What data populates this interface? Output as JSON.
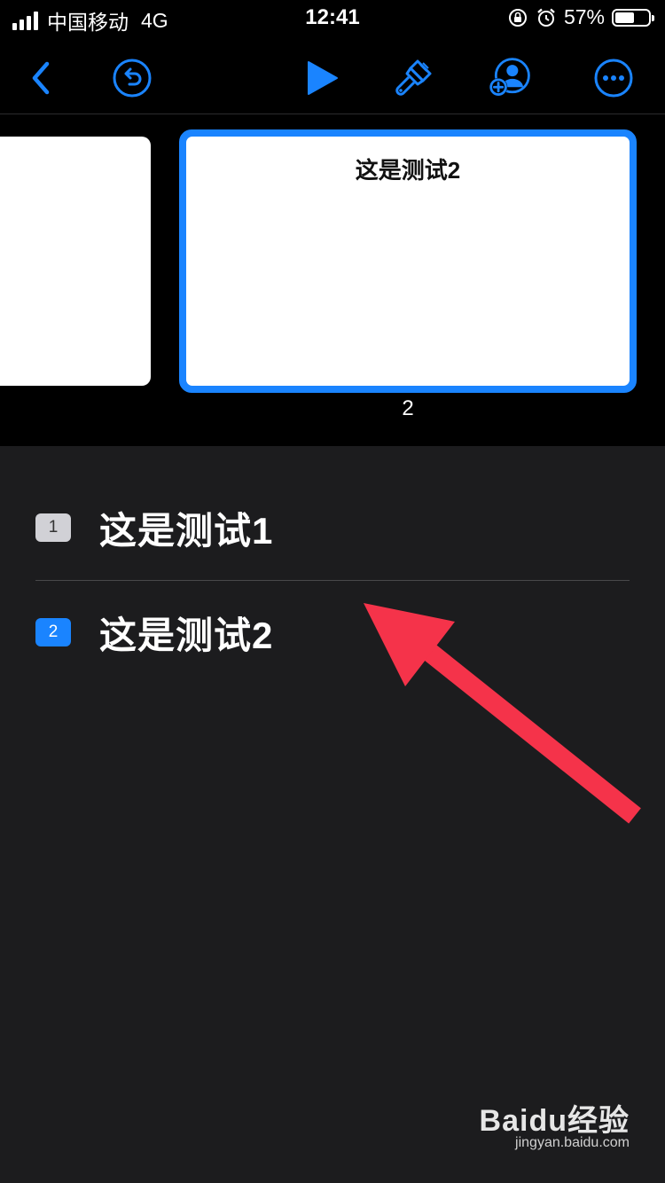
{
  "status_bar": {
    "carrier": "中国移动",
    "network": "4G",
    "time": "12:41",
    "battery_percent": "57%",
    "battery_level": 0.57
  },
  "toolbar": {
    "icons": [
      "back-chevron-icon",
      "undo-icon",
      "play-icon",
      "paintbrush-icon",
      "add-collaborator-icon",
      "more-icon"
    ],
    "accent_color": "#1a84ff"
  },
  "slides": {
    "current_title": "这是测试2",
    "current_number": "2"
  },
  "outline": {
    "items": [
      {
        "number": "1",
        "label": "这是测试1"
      },
      {
        "number": "2",
        "label": "这是测试2"
      }
    ]
  },
  "annotation": {
    "arrow_color": "#f5334a"
  },
  "watermark": {
    "brand": "Baidu经验",
    "url": "jingyan.baidu.com"
  }
}
